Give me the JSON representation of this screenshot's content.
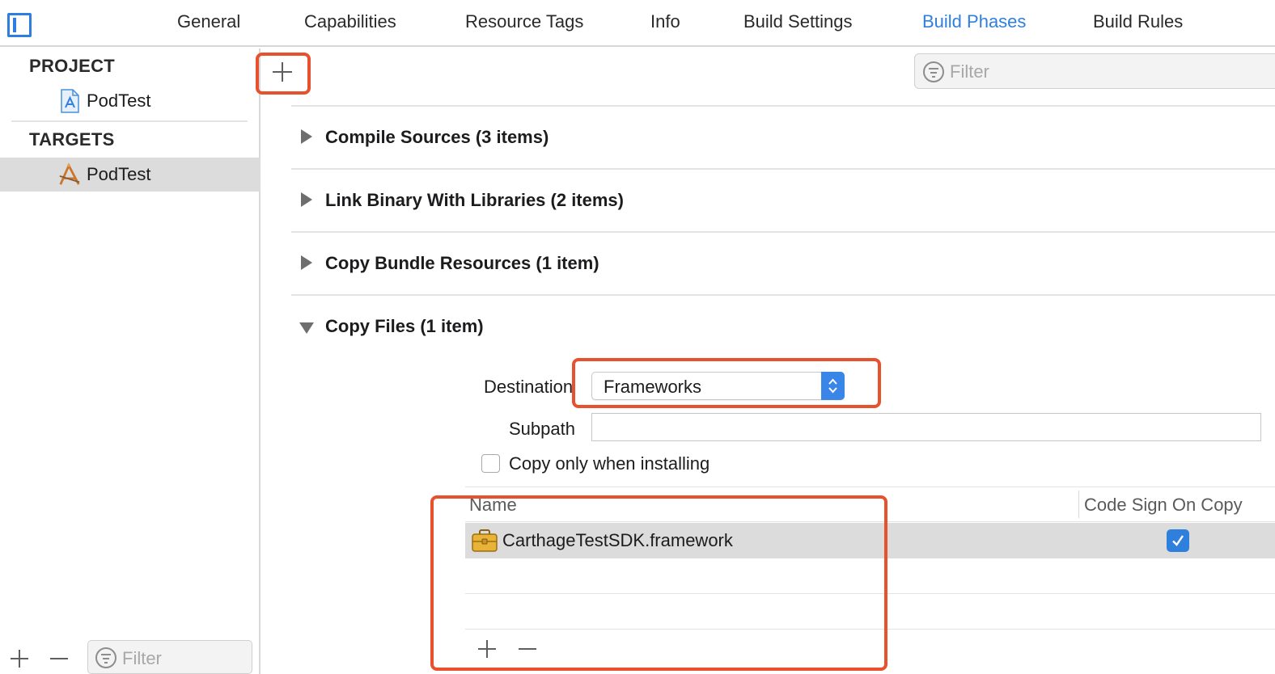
{
  "tabs": [
    {
      "label": "General",
      "active": false
    },
    {
      "label": "Capabilities",
      "active": false
    },
    {
      "label": "Resource Tags",
      "active": false
    },
    {
      "label": "Info",
      "active": false
    },
    {
      "label": "Build Settings",
      "active": false
    },
    {
      "label": "Build Phases",
      "active": true
    },
    {
      "label": "Build Rules",
      "active": false
    }
  ],
  "sidebar": {
    "project_header": "PROJECT",
    "project_item": "PodTest",
    "targets_header": "TARGETS",
    "target_item": "PodTest",
    "filter_placeholder": "Filter"
  },
  "main": {
    "filter_placeholder": "Filter",
    "phases": [
      {
        "title": "Compile Sources (3 items)",
        "expanded": false
      },
      {
        "title": "Link Binary With Libraries (2 items)",
        "expanded": false
      },
      {
        "title": "Copy Bundle Resources (1 item)",
        "expanded": false
      },
      {
        "title": "Copy Files (1 item)",
        "expanded": true
      }
    ],
    "copy_files": {
      "destination_label": "Destination",
      "destination_value": "Frameworks",
      "subpath_label": "Subpath",
      "subpath_value": "",
      "copy_only_label": "Copy only when installing",
      "copy_only_checked": false,
      "table": {
        "col_name": "Name",
        "col_code_sign": "Code Sign On Copy",
        "rows": [
          {
            "name": "CarthageTestSDK.framework",
            "code_sign": true
          }
        ]
      }
    }
  },
  "colors": {
    "accent": "#2f7fdc",
    "highlight": "#e8512d",
    "selection": "#dcdcdc"
  }
}
